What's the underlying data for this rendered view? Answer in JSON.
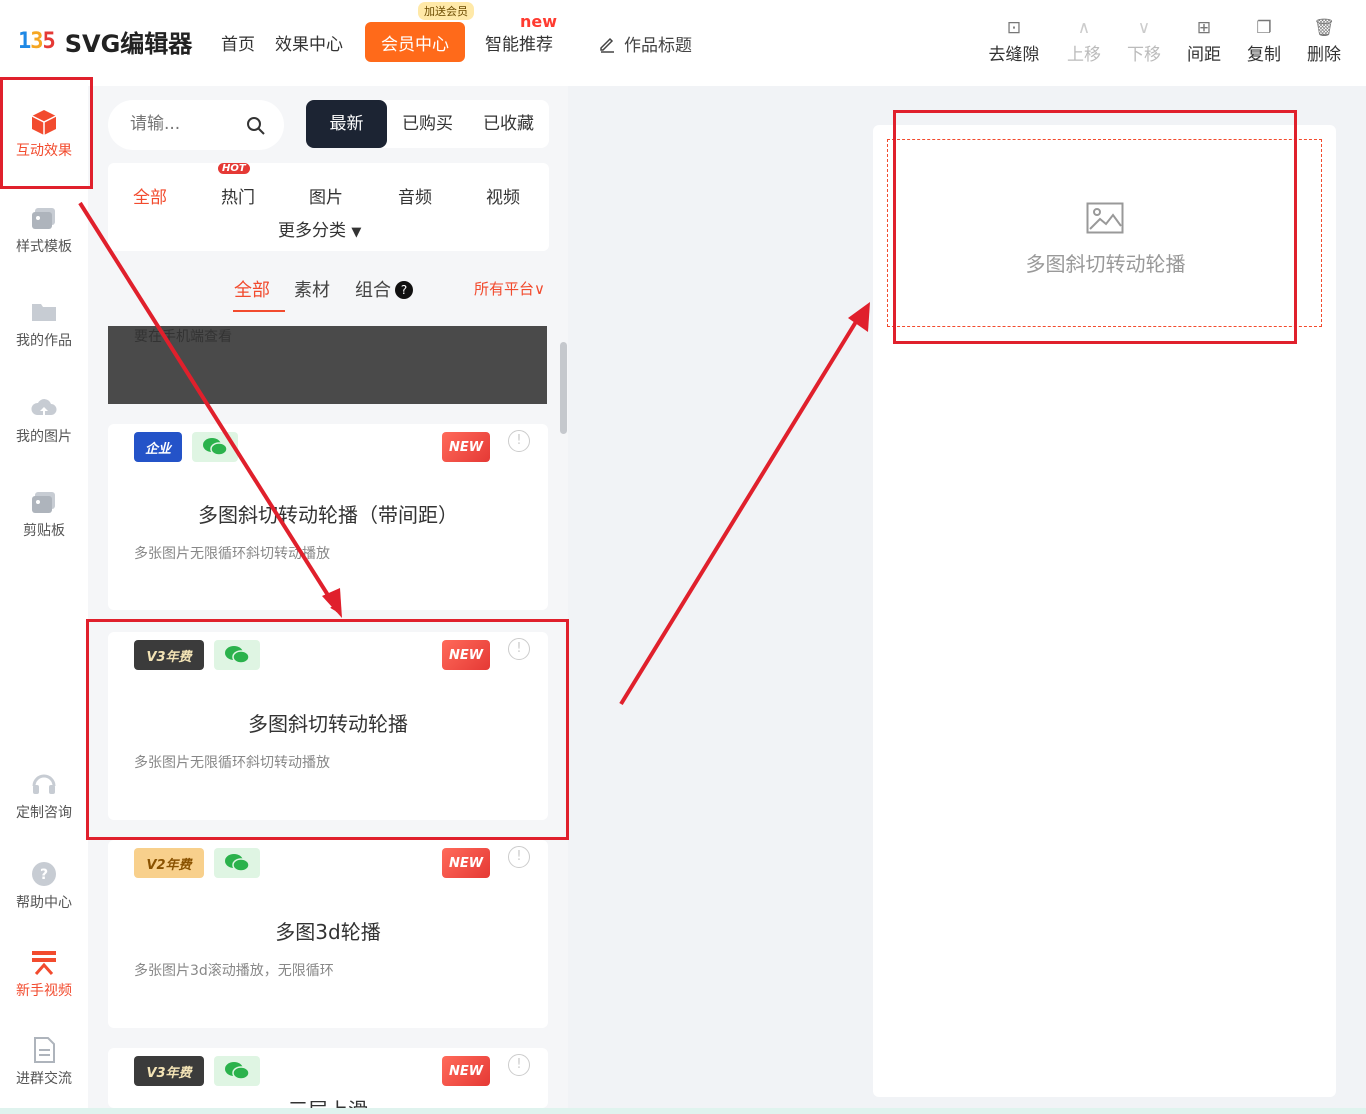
{
  "header": {
    "logo_mark": "135",
    "logo_text": "SVG编辑器",
    "nav": [
      "首页",
      "效果中心"
    ],
    "vip_button": "会员中心",
    "vip_tag": "加送会员",
    "smart_new": "new",
    "smart_label": "智能推荐",
    "title_edit": "作品标题",
    "tools": [
      {
        "label": "去缝隙",
        "icon": "gap-icon",
        "enabled": true
      },
      {
        "label": "上移",
        "icon": "chevron-up-icon",
        "enabled": false
      },
      {
        "label": "下移",
        "icon": "chevron-down-icon",
        "enabled": false
      },
      {
        "label": "间距",
        "icon": "spacing-icon",
        "enabled": true
      },
      {
        "label": "复制",
        "icon": "copy-icon",
        "enabled": true
      },
      {
        "label": "删除",
        "icon": "trash-icon",
        "enabled": true
      }
    ]
  },
  "sidebar": {
    "items": [
      {
        "label": "互动效果",
        "icon": "cube-icon",
        "active": true
      },
      {
        "label": "样式模板",
        "icon": "template-icon"
      },
      {
        "label": "我的作品",
        "icon": "folder-icon"
      },
      {
        "label": "我的图片",
        "icon": "cloud-upload-icon"
      },
      {
        "label": "剪贴板",
        "icon": "clipboard-icon"
      },
      {
        "label": "定制咨询",
        "icon": "headset-icon"
      },
      {
        "label": "帮助中心",
        "icon": "help-icon"
      },
      {
        "label": "新手视频",
        "icon": "video-icon"
      },
      {
        "label": "进群交流",
        "icon": "document-icon"
      }
    ]
  },
  "panel": {
    "search_placeholder": "请输...",
    "segments": [
      "最新",
      "已购买",
      "已收藏"
    ],
    "categories": [
      "全部",
      "热门",
      "图片",
      "音频",
      "视频"
    ],
    "hot_tag": "HOT",
    "more": "更多分类",
    "subtabs": [
      "全部",
      "素材",
      "组合"
    ],
    "subtab_help": "?",
    "platform": "所有平台",
    "cover_text": "要在手机端查看",
    "new_badge": "NEW",
    "info_mark": "!",
    "cards": [
      {
        "badge": "企业",
        "title": "多图斜切转动轮播（带间距）",
        "desc": "多张图片无限循环斜切转动播放"
      },
      {
        "badge": "V3年费",
        "title": "多图斜切转动轮播",
        "desc": "多张图片无限循环斜切转动播放"
      },
      {
        "badge": "V2年费",
        "title": "多图3d轮播",
        "desc": "多张图片3d滚动播放，无限循环"
      },
      {
        "badge": "V3年费",
        "title": "三层上滑",
        "desc": ""
      }
    ]
  },
  "canvas": {
    "placeholder_label": "多图斜切转动轮播"
  },
  "colors": {
    "accent": "#f24b2e",
    "vip": "#ff6a1a",
    "annotation": "#e0202c",
    "dark_tab": "#1c2433"
  }
}
